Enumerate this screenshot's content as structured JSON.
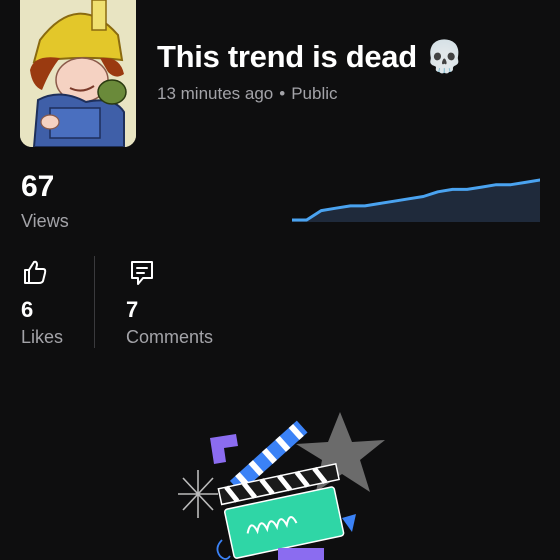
{
  "video": {
    "title": "This trend is dead 💀",
    "posted": "13 minutes ago",
    "visibility": "Public",
    "separator": "•",
    "thumbnail_icon": "cartoon-character-thumbnail"
  },
  "views": {
    "count": "67",
    "label": "Views"
  },
  "views_trend": {
    "line_color": "#4aa3f0",
    "fill_color": "#1f2a3b",
    "values": [
      0,
      0,
      4,
      5,
      6,
      6,
      7,
      8,
      9,
      10,
      12,
      13,
      13,
      14,
      15,
      15,
      16,
      17
    ]
  },
  "likes": {
    "count": "6",
    "label": "Likes",
    "icon": "thumbs-up-icon"
  },
  "comments": {
    "count": "7",
    "label": "Comments",
    "icon": "comment-icon"
  },
  "illustration": {
    "icon": "clapperboard-illustration",
    "colors": {
      "board": "#2fd6a6",
      "stripe": "#3b82f6",
      "star": "#6b6b6b",
      "accent": "#8b6cf0"
    }
  }
}
